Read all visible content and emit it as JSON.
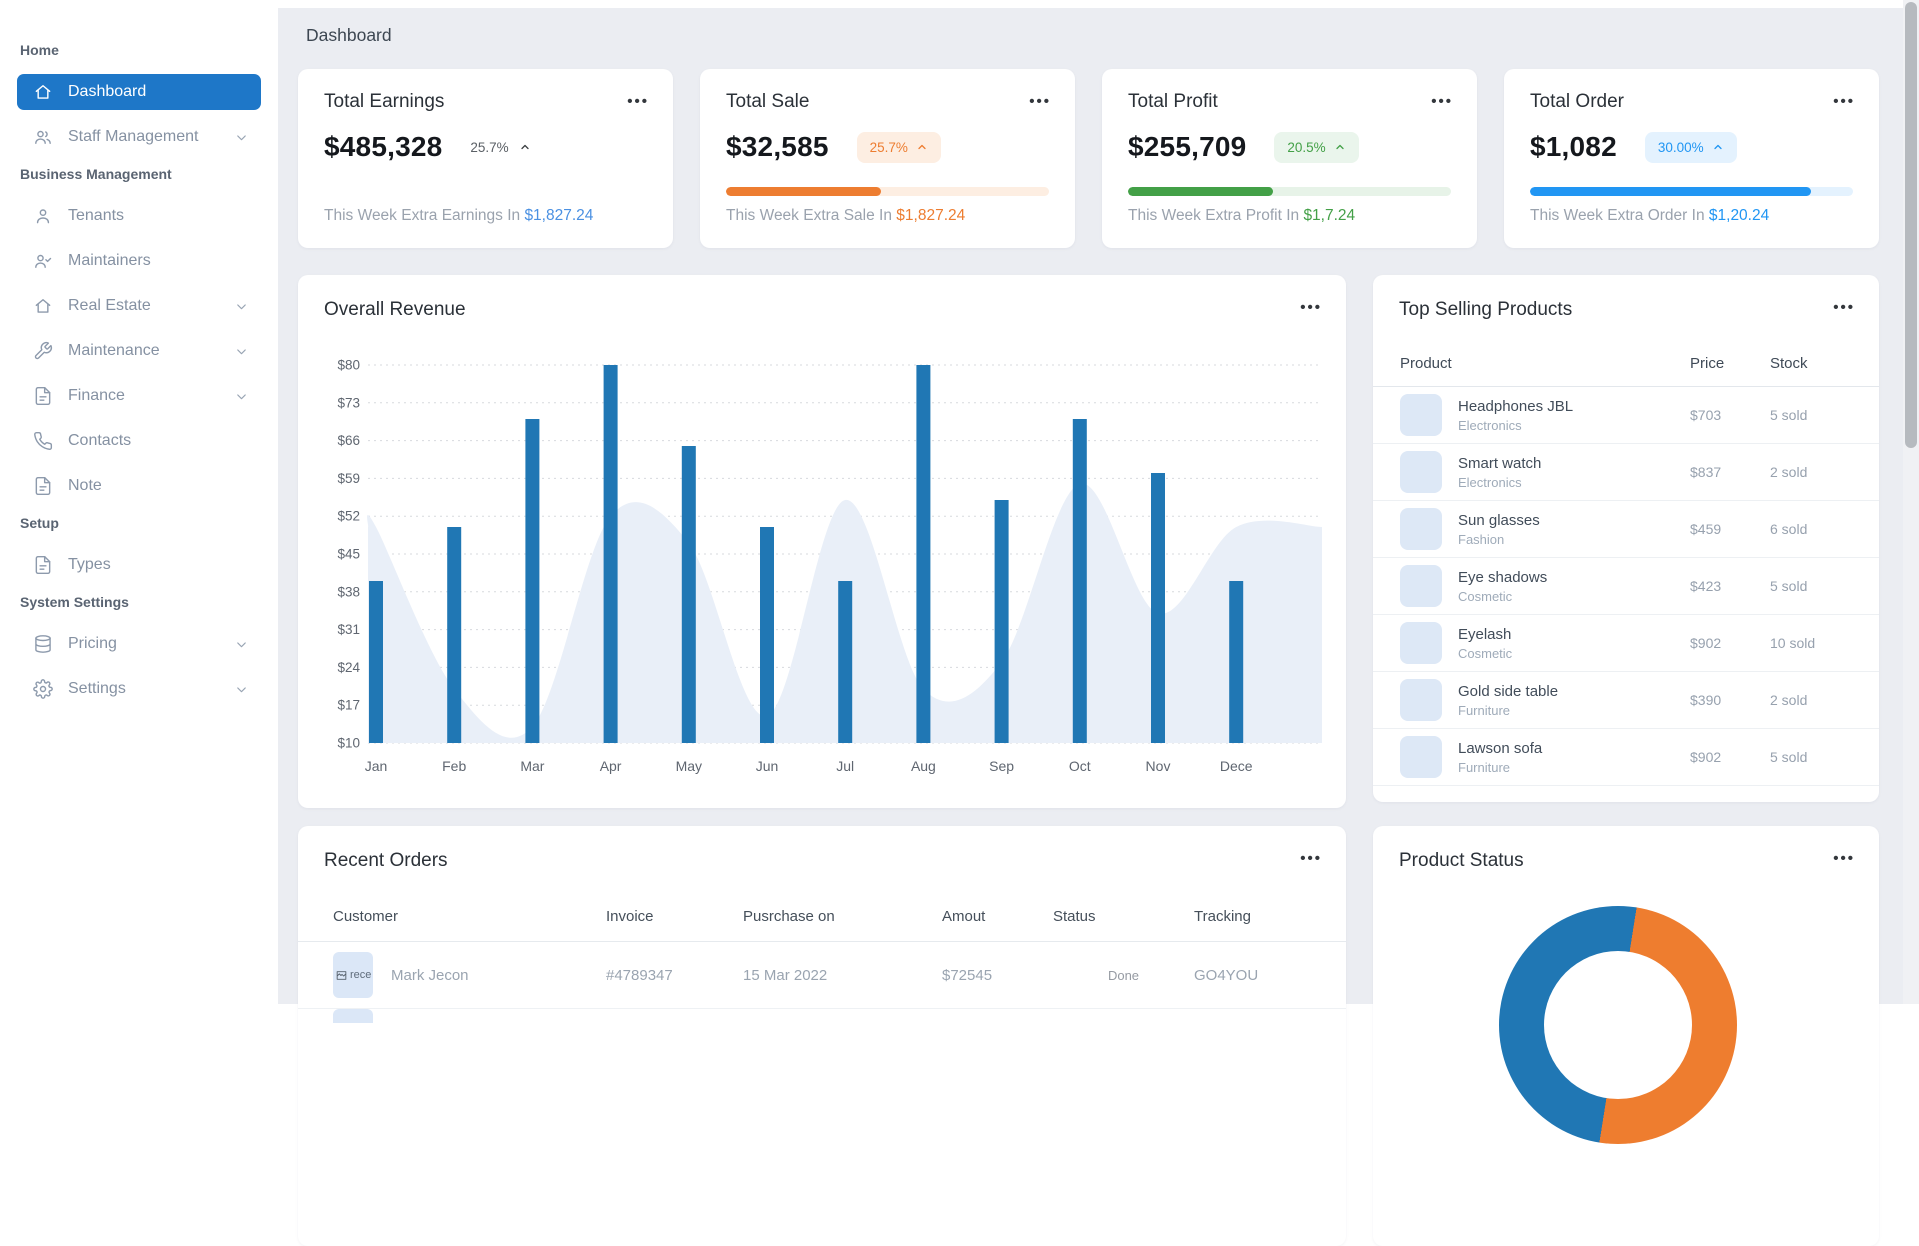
{
  "breadcrumb": "Dashboard",
  "icons": {
    "menu_dots": "•••"
  },
  "sidebar": {
    "sections": [
      {
        "label": "Home",
        "items": [
          {
            "label": "Dashboard",
            "icon": "home",
            "active": true
          },
          {
            "label": "Staff Management",
            "icon": "users",
            "chevron": true
          }
        ]
      },
      {
        "label": "Business Management",
        "items": [
          {
            "label": "Tenants",
            "icon": "user"
          },
          {
            "label": "Maintainers",
            "icon": "user-check"
          },
          {
            "label": "Real Estate",
            "icon": "home",
            "chevron": true
          },
          {
            "label": "Maintenance",
            "icon": "wrench",
            "chevron": true
          },
          {
            "label": "Finance",
            "icon": "file",
            "chevron": true
          },
          {
            "label": "Contacts",
            "icon": "phone"
          },
          {
            "label": "Note",
            "icon": "file"
          }
        ]
      },
      {
        "label": "Setup",
        "items": [
          {
            "label": "Types",
            "icon": "file"
          }
        ]
      },
      {
        "label": "System Settings",
        "items": [
          {
            "label": "Pricing",
            "icon": "database",
            "chevron": true
          },
          {
            "label": "Settings",
            "icon": "gear",
            "chevron": true
          }
        ]
      }
    ]
  },
  "stat_cards": [
    {
      "title": "Total Earnings",
      "value": "$485,328",
      "change": "25.7%",
      "style": "plain",
      "accent": "#4a90e2",
      "badge_bg": null,
      "progress": null,
      "track": null,
      "footer_prefix": "This Week Extra Earnings In",
      "footer_amount": "$1,827.24"
    },
    {
      "title": "Total Sale",
      "value": "$32,585",
      "change": "25.7%",
      "style": "badge",
      "accent": "#ed7d31",
      "badge_bg": "#fdeee2",
      "progress": 48,
      "track": "#fdeee2",
      "footer_prefix": "This Week Extra Sale In",
      "footer_amount": "$1,827.24"
    },
    {
      "title": "Total Profit",
      "value": "$255,709",
      "change": "20.5%",
      "style": "badge",
      "accent": "#43a047",
      "badge_bg": "#eaf5ec",
      "progress": 45,
      "track": "#e7f3e8",
      "footer_prefix": "This Week Extra Profit In",
      "footer_amount": "$1,7.24"
    },
    {
      "title": "Total Order",
      "value": "$1,082",
      "change": "30.00%",
      "style": "badge",
      "accent": "#2196f3",
      "badge_bg": "#e4f2fe",
      "progress": 87,
      "track": "#e4f2fe",
      "footer_prefix": "This Week Extra Order In",
      "footer_amount": "$1,20.24"
    }
  ],
  "revenue": {
    "title": "Overall Revenue",
    "chart_data": {
      "type": "bar",
      "title": "Overall Revenue",
      "categories": [
        "Jan",
        "Feb",
        "Mar",
        "Apr",
        "May",
        "Jun",
        "Jul",
        "Aug",
        "Sep",
        "Oct",
        "Nov",
        "Dece"
      ],
      "series": [
        {
          "name": "revenue-bars",
          "type": "bar",
          "color": "#2077b4",
          "values": [
            40,
            50,
            70,
            80,
            65,
            50,
            40,
            80,
            55,
            70,
            60,
            40
          ]
        },
        {
          "name": "background-area",
          "type": "area",
          "color": "#e9eff8",
          "values": [
            50,
            20,
            13,
            52,
            47,
            15,
            55,
            20,
            25,
            58,
            34,
            50
          ]
        }
      ],
      "y_ticks": [
        "$80",
        "$73",
        "$66",
        "$59",
        "$52",
        "$45",
        "$38",
        "$31",
        "$24",
        "$17",
        "$10"
      ],
      "ylim": [
        10,
        80
      ],
      "xlabel": "",
      "ylabel": "",
      "grid": "horizontal-dotted",
      "legend": "none"
    }
  },
  "top_products": {
    "title": "Top Selling Products",
    "columns": [
      "Product",
      "Price",
      "Stock"
    ],
    "rows": [
      {
        "name": "Headphones JBL",
        "category": "Electronics",
        "price": "$703",
        "stock": "5 sold"
      },
      {
        "name": "Smart watch",
        "category": "Electronics",
        "price": "$837",
        "stock": "2 sold"
      },
      {
        "name": "Sun glasses",
        "category": "Fashion",
        "price": "$459",
        "stock": "6 sold"
      },
      {
        "name": "Eye shadows",
        "category": "Cosmetic",
        "price": "$423",
        "stock": "5 sold"
      },
      {
        "name": "Eyelash",
        "category": "Cosmetic",
        "price": "$902",
        "stock": "10 sold"
      },
      {
        "name": "Gold side table",
        "category": "Furniture",
        "price": "$390",
        "stock": "2 sold"
      },
      {
        "name": "Lawson sofa",
        "category": "Furniture",
        "price": "$902",
        "stock": "5 sold"
      }
    ]
  },
  "recent_orders": {
    "title": "Recent Orders",
    "columns": [
      "Customer",
      "Invoice",
      "Pusrchase on",
      "Amout",
      "Status",
      "Tracking"
    ],
    "rows": [
      {
        "customer": "Mark Jecon",
        "avatar_alt": "rece",
        "invoice": "#4789347",
        "purchase_on": "15 Mar 2022",
        "amount": "$72545",
        "status": "Done",
        "tracking": "GO4YOU"
      }
    ]
  },
  "product_status": {
    "title": "Product Status",
    "chart_data": {
      "type": "pie",
      "donut": true,
      "rotation_deg": 9,
      "slices": [
        {
          "label": "segment-1",
          "color": "#ee7d2f",
          "percent": 50
        },
        {
          "label": "segment-2",
          "color": "#2077b4",
          "percent": 50
        }
      ],
      "legend": "none"
    }
  }
}
